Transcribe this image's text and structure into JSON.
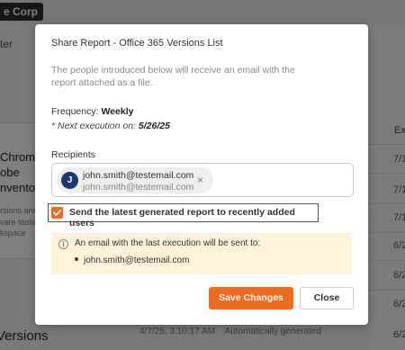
{
  "background": {
    "corp_label": "e Corp",
    "filter_label": "ter",
    "card_title": "Chrome\nobe\nnvento",
    "card_desc": "rsions and\nvare tools\nkspace",
    "bottom_label": "Versions",
    "column_header": "Exp",
    "row_values": [
      "7/1",
      "7/1",
      "7/1",
      "6/2",
      "6/2",
      "6/2",
      "6/2"
    ],
    "bottom_text": "4/7/25, 3:10:17 AM    Automatically generated"
  },
  "modal": {
    "title": "Share Report - Office 365 Versions List",
    "description": "The people introduced below will receive an email with the report attached as a file.",
    "frequency_label": "Frequency:",
    "frequency_value": "Weekly",
    "next_execution_label": "* Next execution on:",
    "next_execution_value": "5/26/25",
    "recipients_label": "Recipients",
    "recipient": {
      "initial": "J",
      "name_line": "john.smith@testemail.com",
      "email_line": "john.smith@testemail.com",
      "remove_glyph": "×"
    },
    "checkbox": {
      "checked": true,
      "label": "Send the latest generated report to recently added users"
    },
    "info": {
      "icon_glyph": "i",
      "text": "An email with the last execution will be sent to:",
      "items": [
        "john.smith@testemail.com"
      ]
    },
    "save_label": "Save Changes",
    "close_label": "Close"
  },
  "colors": {
    "accent": "#f26a1b",
    "avatar": "#1a3a6e",
    "info_background": "#fdf3d9"
  }
}
